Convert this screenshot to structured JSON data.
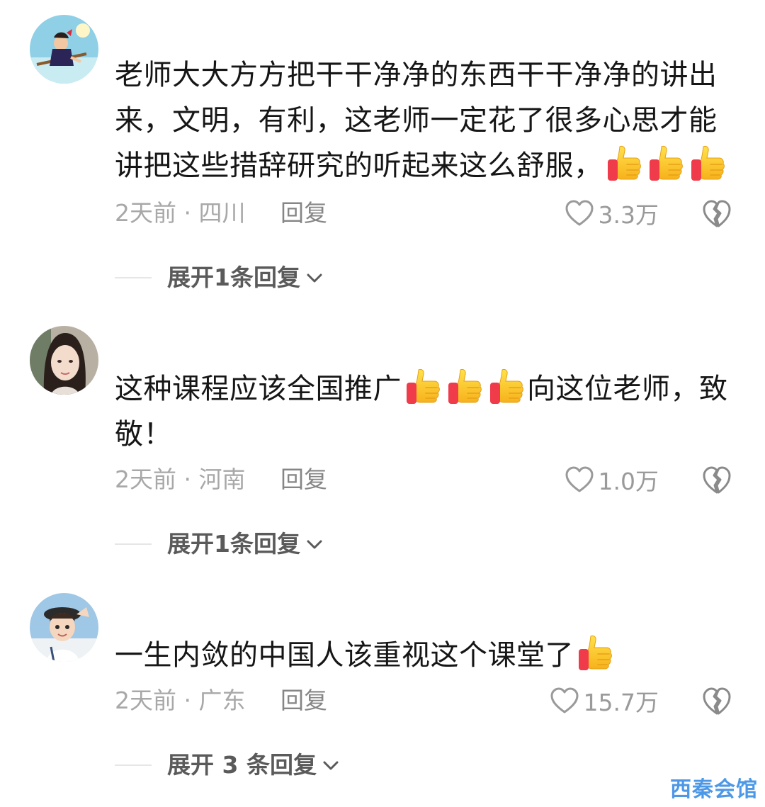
{
  "comments": [
    {
      "text_parts": [
        "老师大大方方把干干净净的东西干干净净的讲出来，文明，有利，这老师一定花了很多心思才能讲把这些措辞研究的听起来这么舒服，"
      ],
      "time_location": "2天前 · 四川",
      "reply_label": "回复",
      "likes": "3.3万",
      "expand_label": "展开1条回复"
    },
    {
      "text_parts": [
        "这种课程应该全国推广",
        "向这位老师，致敬！"
      ],
      "time_location": "2天前 · 河南",
      "reply_label": "回复",
      "likes": "1.0万",
      "expand_label": "展开1条回复"
    },
    {
      "text_parts": [
        "一生内敛的中国人该重视这个课堂了"
      ],
      "time_location": "2天前 · 广东",
      "reply_label": "回复",
      "likes": "15.7万",
      "expand_label": "展开 3 条回复"
    }
  ],
  "watermark": "西秦会馆",
  "icons": {
    "like": "heart-outline-icon",
    "dislike": "broken-heart-icon",
    "expand": "chevron-down-icon",
    "emoji": "thumbs-up-emoji"
  },
  "colors": {
    "text": "#161616",
    "meta": "#a8a8a8",
    "watermark": "#4d98e6"
  }
}
